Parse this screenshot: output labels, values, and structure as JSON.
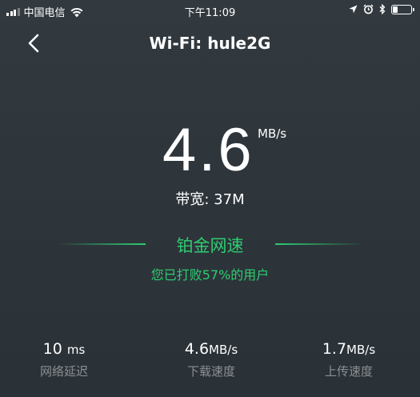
{
  "status_bar": {
    "carrier": "中国电信",
    "time": "下午11:09",
    "battery_level": 0.3
  },
  "nav": {
    "title": "Wi-Fi: hule2G"
  },
  "speed": {
    "value": "4.6",
    "unit": "MB/s",
    "bandwidth": "带宽: 37M"
  },
  "grade": {
    "label": "铂金网速",
    "beat_text": "您已打败57%的用户",
    "color": "#2ecc71"
  },
  "stats": {
    "ping": {
      "value": "10",
      "unit": "ms",
      "label": "网络延迟"
    },
    "download": {
      "value": "4.6",
      "unit": "MB/s",
      "label": "下载速度"
    },
    "upload": {
      "value": "1.7",
      "unit": "MB/s",
      "label": "上传速度"
    }
  }
}
